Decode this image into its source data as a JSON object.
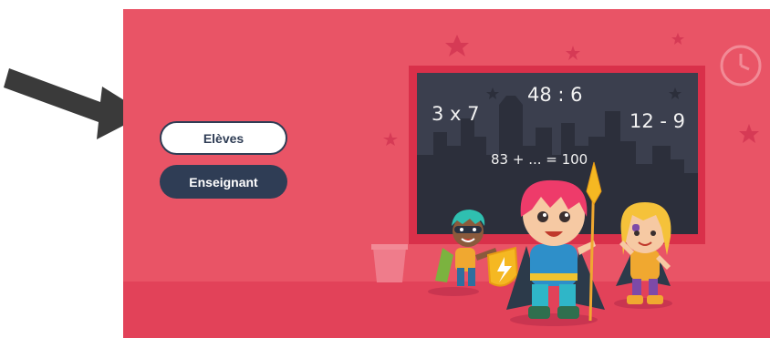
{
  "buttons": {
    "eleves_label": "Elèves",
    "enseignant_label": "Enseignant"
  },
  "chalkboard": {
    "eq1": "3 x 7",
    "eq2": "48 : 6",
    "eq3": "12 - 9",
    "eq4": "83 + ... = 100"
  },
  "colors": {
    "background": "#e95466",
    "floor": "#e24259",
    "board_frame": "#d9304a",
    "board": "#3b3f4e",
    "button_dark": "#2f3d55"
  },
  "icons": [
    "pointer-arrow-icon",
    "clock-icon",
    "star-icon",
    "trash-bin-icon"
  ]
}
